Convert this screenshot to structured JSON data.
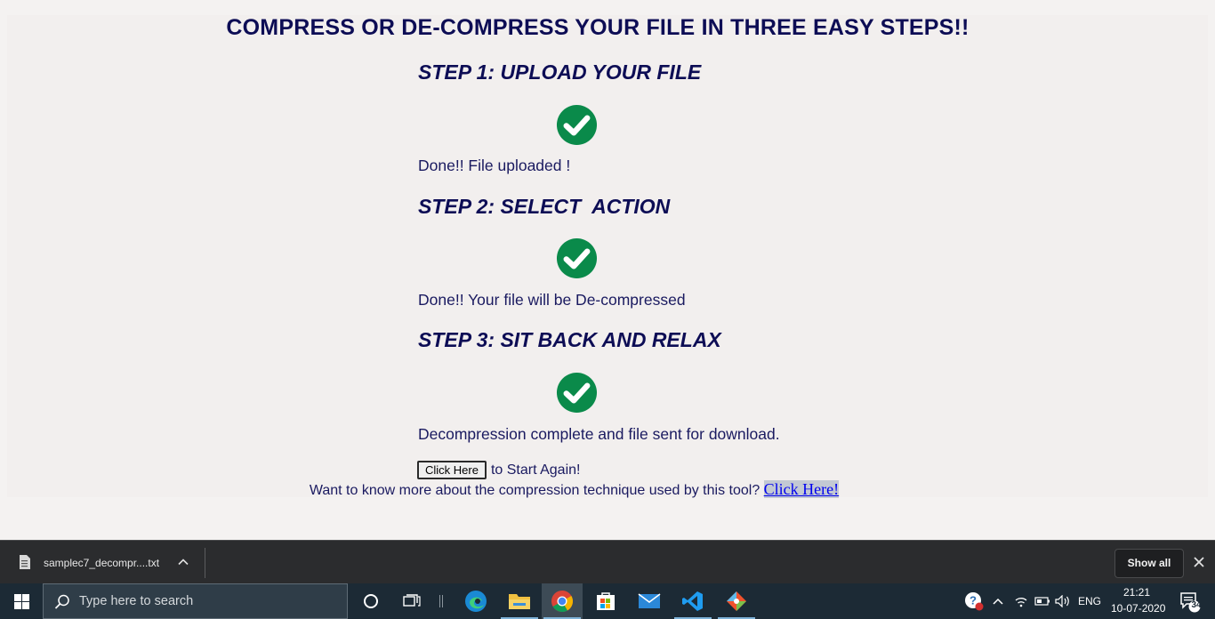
{
  "page": {
    "title": "COMPRESS OR DE-COMPRESS YOUR FILE IN THREE EASY STEPS!!",
    "steps": [
      {
        "heading": "STEP 1: UPLOAD YOUR FILE",
        "status": "Done!! File uploaded !"
      },
      {
        "heading": "STEP 2: SELECT  ACTION",
        "status": "Done!! Your file will be De-compressed"
      },
      {
        "heading": "STEP 3: SIT BACK AND RELAX",
        "status": "Decompression complete and file sent for download."
      }
    ],
    "restart_button": "Click Here",
    "restart_suffix": "to Start Again!",
    "info_text": "Want to know more about the compression technique used by this tool?",
    "info_link": "Click Here!"
  },
  "downloads": {
    "file_name": "samplec7_decompr....txt",
    "show_all": "Show all"
  },
  "taskbar": {
    "search_placeholder": "Type here to search",
    "language": "ENG",
    "time": "21:21",
    "date": "10-07-2020",
    "notification_count": "34"
  },
  "colors": {
    "heading": "#0d0d55",
    "check_green": "#0a8a4a",
    "taskbar": "#1c2a35",
    "download_bar": "#2b2c2e"
  }
}
